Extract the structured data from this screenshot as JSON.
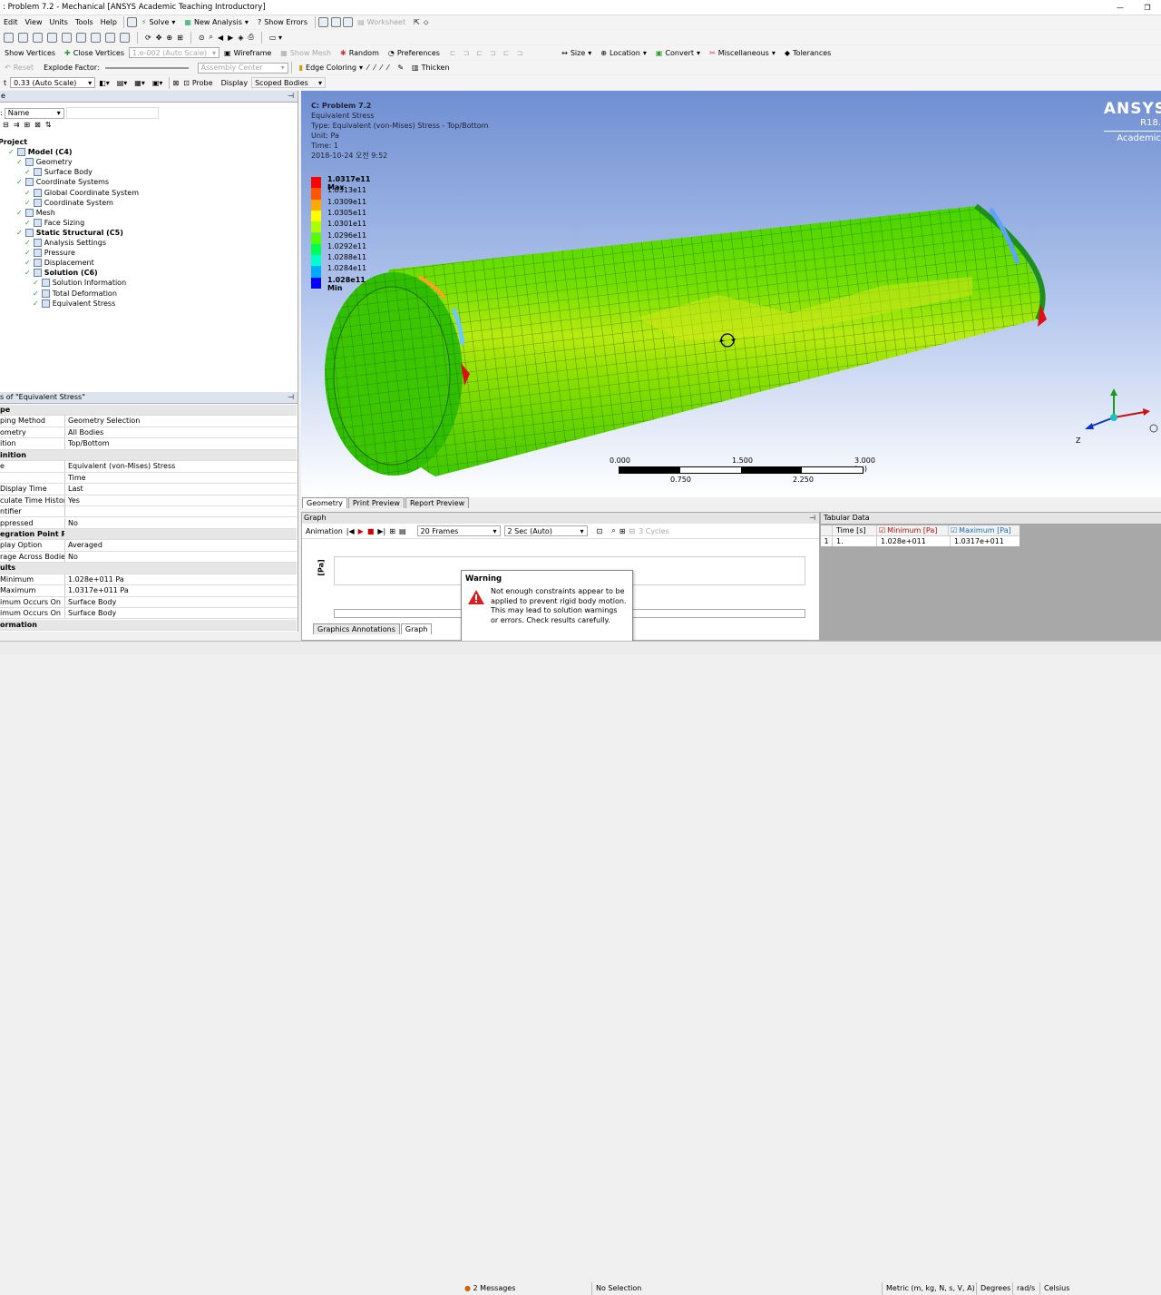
{
  "window": {
    "title": ": Problem 7.2 - Mechanical [ANSYS Academic Teaching Introductory]"
  },
  "menu": [
    "Edit",
    "View",
    "Units",
    "Tools",
    "Help"
  ],
  "toolbar1": {
    "solve": "Solve",
    "new_analysis": "New Analysis",
    "show_errors": "Show Errors",
    "worksheet": "Worksheet"
  },
  "toolbar3": {
    "show_vertices": "Show Vertices",
    "close_vertices": "Close Vertices",
    "scale": "1.e-002 (Auto Scale)",
    "wireframe": "Wireframe",
    "show_mesh": "Show Mesh",
    "random": "Random",
    "preferences": "Preferences",
    "size": "Size",
    "location": "Location",
    "convert": "Convert",
    "miscellaneous": "Miscellaneous",
    "tolerances": "Tolerances"
  },
  "toolbar4": {
    "reset": "Reset",
    "explode_factor": "Explode Factor:",
    "assembly_center": "Assembly Center",
    "edge_coloring": "Edge Coloring",
    "thicken": "Thicken"
  },
  "toolbar5": {
    "scale_value": "0.33 (Auto Scale)",
    "probe": "Probe",
    "display": "Display",
    "scoped_bodies": "Scoped Bodies"
  },
  "outline": {
    "header": "e",
    "filter_label": ":",
    "filter_value": "Name",
    "items": [
      {
        "label": "Project",
        "depth": 0,
        "bold": true
      },
      {
        "label": "Model (C4)",
        "depth": 1,
        "bold": true
      },
      {
        "label": "Geometry",
        "depth": 2,
        "bold": false
      },
      {
        "label": "Surface Body",
        "depth": 3,
        "bold": false
      },
      {
        "label": "Coordinate Systems",
        "depth": 2,
        "bold": false
      },
      {
        "label": "Global Coordinate System",
        "depth": 3,
        "bold": false
      },
      {
        "label": "Coordinate System",
        "depth": 3,
        "bold": false
      },
      {
        "label": "Mesh",
        "depth": 2,
        "bold": false
      },
      {
        "label": "Face Sizing",
        "depth": 3,
        "bold": false
      },
      {
        "label": "Static Structural (C5)",
        "depth": 2,
        "bold": true
      },
      {
        "label": "Analysis Settings",
        "depth": 3,
        "bold": false
      },
      {
        "label": "Pressure",
        "depth": 3,
        "bold": false
      },
      {
        "label": "Displacement",
        "depth": 3,
        "bold": false
      },
      {
        "label": "Solution (C6)",
        "depth": 3,
        "bold": true
      },
      {
        "label": "Solution Information",
        "depth": 4,
        "bold": false
      },
      {
        "label": "Total Deformation",
        "depth": 4,
        "bold": false
      },
      {
        "label": "Equivalent Stress",
        "depth": 4,
        "bold": false
      }
    ]
  },
  "details": {
    "title": "s of \"Equivalent Stress\"",
    "rows": [
      {
        "k": "pe",
        "v": "",
        "cat": true
      },
      {
        "k": "ping Method",
        "v": "Geometry Selection",
        "cat": false
      },
      {
        "k": "ometry",
        "v": "All Bodies",
        "cat": false
      },
      {
        "k": "ition",
        "v": "Top/Bottom",
        "cat": false
      },
      {
        "k": "inition",
        "v": "",
        "cat": true
      },
      {
        "k": "e",
        "v": "Equivalent (von-Mises) Stress",
        "cat": false
      },
      {
        "k": "",
        "v": "Time",
        "cat": false
      },
      {
        "k": "Display Time",
        "v": "Last",
        "cat": false
      },
      {
        "k": "culate Time History",
        "v": "Yes",
        "cat": false
      },
      {
        "k": "ntifier",
        "v": "",
        "cat": false
      },
      {
        "k": "ppressed",
        "v": "No",
        "cat": false
      },
      {
        "k": "egration Point Results",
        "v": "",
        "cat": true
      },
      {
        "k": "play Option",
        "v": "Averaged",
        "cat": false
      },
      {
        "k": "rage Across Bodies",
        "v": "No",
        "cat": false
      },
      {
        "k": "ults",
        "v": "",
        "cat": true
      },
      {
        "k": "Minimum",
        "v": "1.028e+011 Pa",
        "cat": false
      },
      {
        "k": "Maximum",
        "v": "1.0317e+011 Pa",
        "cat": false
      },
      {
        "k": "imum Occurs On",
        "v": "Surface Body",
        "cat": false
      },
      {
        "k": "imum Occurs On",
        "v": "Surface Body",
        "cat": false
      },
      {
        "k": "ormation",
        "v": "",
        "cat": true
      }
    ]
  },
  "viewport": {
    "info": {
      "title": "C: Problem 7.2",
      "result": "Equivalent Stress",
      "type": "Type: Equivalent (von-Mises) Stress - Top/Bottom",
      "unit": "Unit: Pa",
      "time": "Time: 1",
      "date": "2018-10-24 오전 9:52"
    },
    "legend": {
      "max": "1.0317e11 Max",
      "labels": [
        "1.0313e11",
        "1.0309e11",
        "1.0305e11",
        "1.0301e11",
        "1.0296e11",
        "1.0292e11",
        "1.0288e11",
        "1.0284e11"
      ],
      "min": "1.028e11 Min",
      "colors": [
        "#ff0000",
        "#ff5500",
        "#ffaa00",
        "#ffff00",
        "#aaff00",
        "#55ff00",
        "#00ff55",
        "#00ffcc",
        "#00aaff",
        "#0000ff"
      ]
    },
    "logo": {
      "brand": "ANSYS",
      "version": "R18.",
      "edition": "Academic"
    },
    "scale_bar": {
      "t0": "0.000",
      "t1": "1.500",
      "t2": "3.000 (m)",
      "b1": "0.750",
      "b2": "2.250"
    },
    "triad": {
      "z": "Z"
    },
    "tabs": [
      "Geometry",
      "Print Preview",
      "Report Preview"
    ]
  },
  "graph": {
    "title": "Graph",
    "animation": "Animation",
    "frames": "20 Frames",
    "duration": "2 Sec (Auto)",
    "cycles": "3 Cycles",
    "yunit": "[Pa]",
    "tabs": [
      "Graphics Annotations",
      "Graph"
    ]
  },
  "tabular": {
    "title": "Tabular Data",
    "headers": [
      "Time [s]",
      "Minimum [Pa]",
      "Maximum [Pa]"
    ],
    "row": [
      "1",
      "1.",
      "1.028e+011",
      "1.0317e+011"
    ]
  },
  "warning": {
    "title": "Warning",
    "text": "Not enough constraints appear to be applied to prevent rigid body motion. This may lead to solution warnings or errors. Check results carefully."
  },
  "status": {
    "messages": "2 Messages",
    "selection": "No Selection",
    "units": "Metric (m, kg, N, s, V, A)",
    "angle": "Degrees",
    "rate": "rad/s",
    "temp": "Celsius"
  }
}
